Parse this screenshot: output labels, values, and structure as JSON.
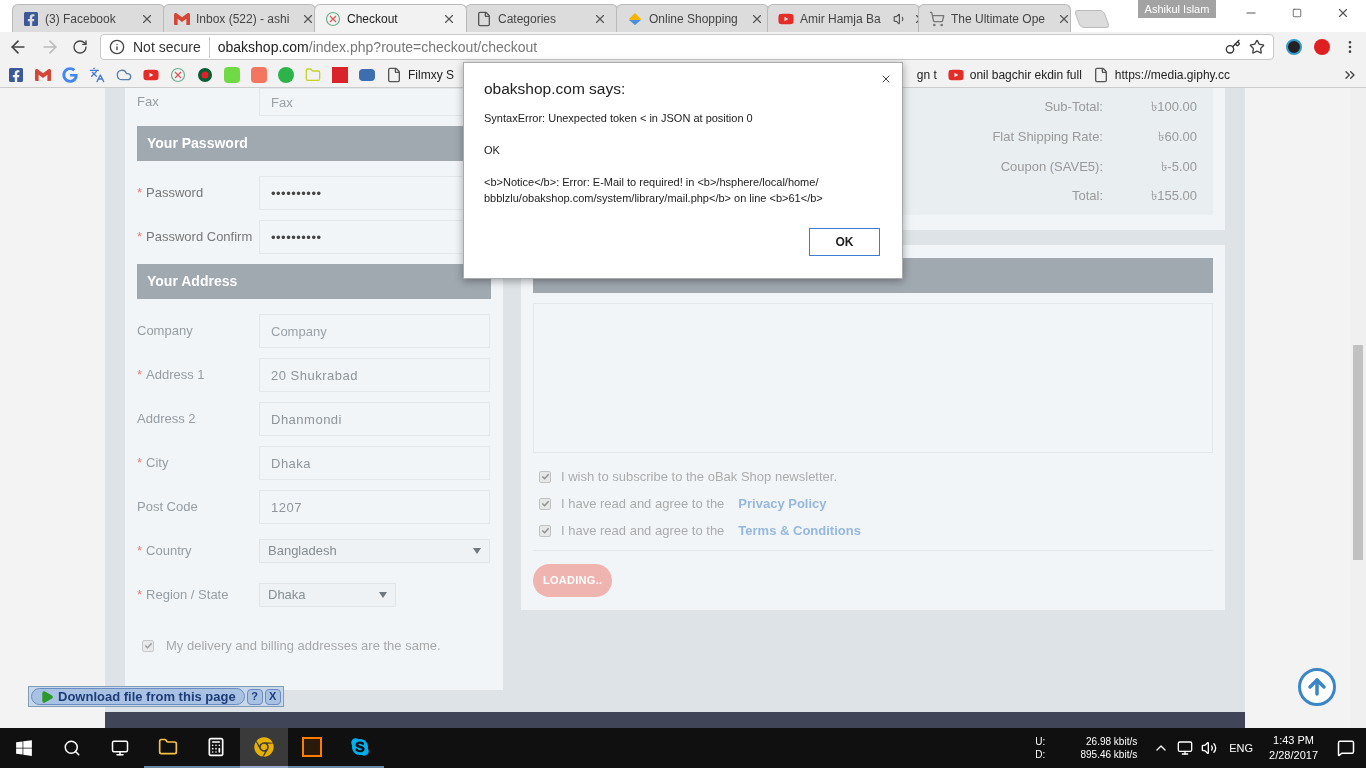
{
  "browser": {
    "tabs": [
      {
        "label": "(3) Facebook",
        "kind": "facebook",
        "selected": false,
        "audio": false
      },
      {
        "label": "Inbox (522) - ashi",
        "kind": "gmail",
        "selected": false,
        "audio": false
      },
      {
        "label": "Checkout",
        "kind": "shop",
        "selected": true,
        "audio": false
      },
      {
        "label": "Categories",
        "kind": "page",
        "selected": false,
        "audio": false
      },
      {
        "label": "Online Shopping",
        "kind": "wallet",
        "selected": false,
        "audio": false
      },
      {
        "label": "Amir Hamja Ba",
        "kind": "youtube",
        "selected": false,
        "audio": true
      },
      {
        "label": "The Ultimate Ope",
        "kind": "cart",
        "selected": false,
        "audio": false
      }
    ],
    "profile": "Ashikul Islam",
    "address": {
      "security": "Not secure",
      "host": "obakshop.com",
      "path": "/index.php?route=checkout/checkout"
    },
    "bookmarks": [
      {
        "kind": "facebook"
      },
      {
        "kind": "gmail"
      },
      {
        "kind": "google"
      },
      {
        "kind": "translate"
      },
      {
        "kind": "cloud"
      },
      {
        "kind": "youtube"
      },
      {
        "kind": "shop"
      },
      {
        "kind": "dot"
      },
      {
        "kind": "green-square"
      },
      {
        "kind": "orange-square"
      },
      {
        "kind": "green-circle"
      },
      {
        "kind": "folder"
      },
      {
        "kind": "red-square"
      },
      {
        "kind": "banner"
      },
      {
        "kind": "page",
        "label": "Filmxy S"
      }
    ],
    "bookmarks_right": [
      {
        "kind": "partial",
        "label": "gn t"
      },
      {
        "kind": "youtube",
        "label": "onil bagchir ekdin full"
      },
      {
        "kind": "page",
        "label": "https://media.giphy.cc"
      }
    ]
  },
  "left_panel": {
    "sections": [
      {
        "disabled": true,
        "fields": [
          {
            "kind": "text",
            "label": "Fax",
            "placeholder": "Fax"
          }
        ]
      },
      {
        "title": "Your Password",
        "disabled": false,
        "fields": [
          {
            "kind": "text",
            "label": "Password",
            "marker": "*",
            "value": "••••••••••"
          },
          {
            "kind": "text",
            "label": "Password Confirm",
            "marker": "*",
            "value": "••••••••••"
          }
        ]
      },
      {
        "title": "Your Address",
        "disabled": true,
        "fields": [
          {
            "kind": "text",
            "label": "Company",
            "placeholder": "Company"
          },
          {
            "kind": "text",
            "label": "Address 1",
            "marker": "*",
            "value": "20 Shukrabad"
          },
          {
            "kind": "text",
            "label": "Address 2",
            "value": "Dhanmondi"
          },
          {
            "kind": "text",
            "label": "City",
            "marker": "*",
            "value": "Dhaka"
          },
          {
            "kind": "text",
            "label": "Post Code",
            "value": "1207"
          },
          {
            "kind": "select",
            "label": "Country",
            "marker": "*",
            "value": "Bangladesh"
          },
          {
            "kind": "select-narrow",
            "label": "Region / State",
            "marker": "*",
            "value": "Dhaka"
          }
        ]
      }
    ],
    "same_address": {
      "label": "My delivery and billing addresses are the same.",
      "checked": true
    }
  },
  "totals": [
    {
      "label": "Sub-Total:",
      "value": "৳100.00"
    },
    {
      "label": "Flat Shipping Rate:",
      "value": "৳60.00"
    },
    {
      "label": "Coupon (SAVE5):",
      "value": "৳-5.00"
    },
    {
      "label": "Total:",
      "value": "৳155.00"
    }
  ],
  "agreements": [
    {
      "label": "I wish to subscribe to the oBak Shop newsletter.",
      "checked": true
    },
    {
      "label": "I have read and agree to the",
      "link": "Privacy Policy",
      "checked": true
    },
    {
      "label": "I have read and agree to the",
      "link": "Terms & Conditions",
      "checked": true
    }
  ],
  "confirm_button": {
    "label": "LOADING..",
    "disabled": true
  },
  "dialog": {
    "title": "obakshop.com says:",
    "lines": [
      "SyntaxError: Unexpected token < in JSON at position 0",
      "OK",
      "<b>Notice</b>: Error: E-Mail to required! in <b>/hsphere/local/home/ bbblzlu/obakshop.com/system/library/mail.php</b> on line <b>61</b>"
    ],
    "button": "OK"
  },
  "download_bar": {
    "label": "Download file from this page",
    "help": "?",
    "close": "X"
  },
  "taskbar": {
    "apps": [
      {
        "kind": "explorer",
        "active": false
      },
      {
        "kind": "calculator",
        "active": false
      },
      {
        "kind": "chrome",
        "active": true
      },
      {
        "kind": "illustrator",
        "active": false
      },
      {
        "kind": "skype",
        "active": false
      }
    ],
    "net": [
      {
        "label": "U:",
        "value": "26.98 kbit/s"
      },
      {
        "label": "D:",
        "value": "895.46 kbit/s"
      }
    ],
    "language": "ENG",
    "time": "1:43 PM",
    "date": "2/28/2017"
  }
}
